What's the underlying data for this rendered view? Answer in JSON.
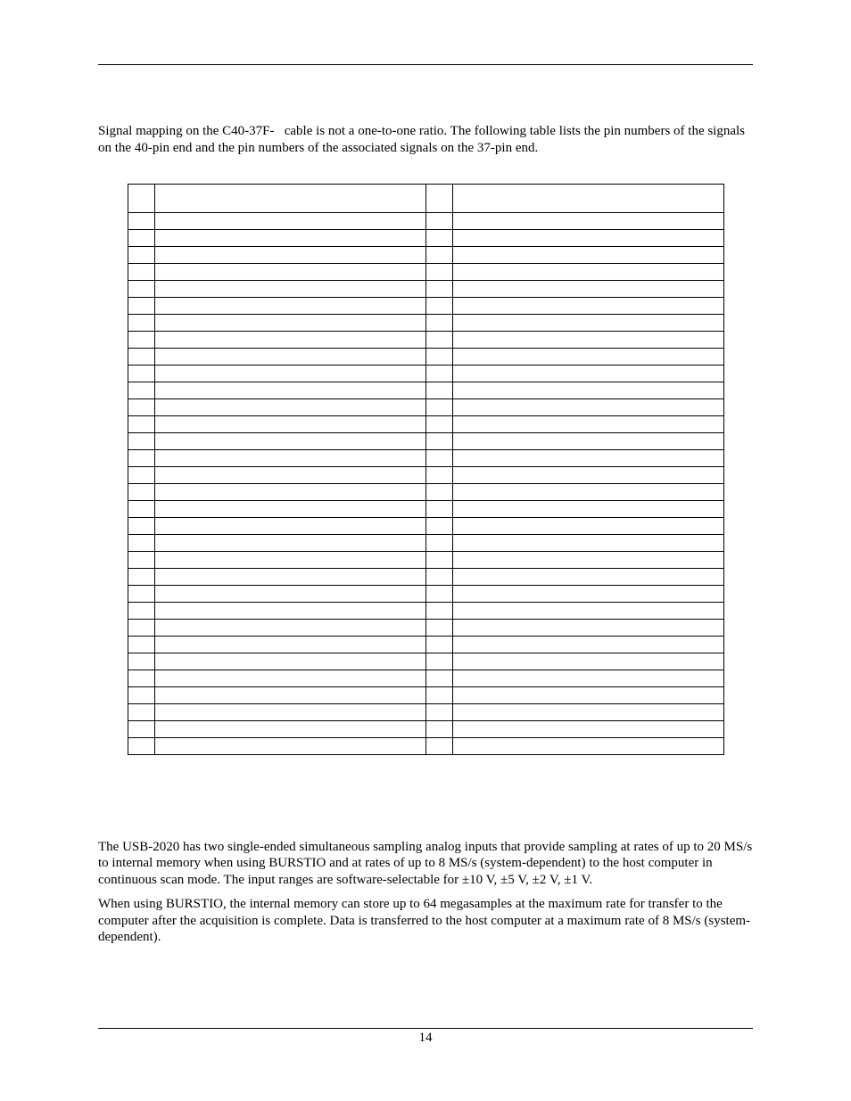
{
  "intro": {
    "text": "Signal mapping on the C40-37F-   cable is not a one-to-one ratio. The following table lists the pin numbers of the signals on the 40-pin end and the pin numbers of the associated signals on the 37-pin end."
  },
  "table": {
    "headers": {
      "left_pin": "",
      "left_signal": "",
      "right_pin": "",
      "right_signal": ""
    },
    "rows": [
      {
        "lp": "",
        "ls": "",
        "rp": "",
        "rs": ""
      },
      {
        "lp": "",
        "ls": "",
        "rp": "",
        "rs": ""
      },
      {
        "lp": "",
        "ls": "",
        "rp": "",
        "rs": ""
      },
      {
        "lp": "",
        "ls": "",
        "rp": "",
        "rs": ""
      },
      {
        "lp": "",
        "ls": "",
        "rp": "",
        "rs": ""
      },
      {
        "lp": "",
        "ls": "",
        "rp": "",
        "rs": ""
      },
      {
        "lp": "",
        "ls": "",
        "rp": "",
        "rs": ""
      },
      {
        "lp": "",
        "ls": "",
        "rp": "",
        "rs": ""
      },
      {
        "lp": "",
        "ls": "",
        "rp": "",
        "rs": ""
      },
      {
        "lp": "",
        "ls": "",
        "rp": "",
        "rs": ""
      },
      {
        "lp": "",
        "ls": "",
        "rp": "",
        "rs": ""
      },
      {
        "lp": "",
        "ls": "",
        "rp": "",
        "rs": ""
      },
      {
        "lp": "",
        "ls": "",
        "rp": "",
        "rs": ""
      },
      {
        "lp": "",
        "ls": "",
        "rp": "",
        "rs": ""
      },
      {
        "lp": "",
        "ls": "",
        "rp": "",
        "rs": ""
      },
      {
        "lp": "",
        "ls": "",
        "rp": "",
        "rs": ""
      },
      {
        "lp": "",
        "ls": "",
        "rp": "",
        "rs": ""
      },
      {
        "lp": "",
        "ls": "",
        "rp": "",
        "rs": ""
      },
      {
        "lp": "",
        "ls": "",
        "rp": "",
        "rs": ""
      },
      {
        "lp": "",
        "ls": "",
        "rp": "",
        "rs": ""
      },
      {
        "lp": "",
        "ls": "",
        "rp": "",
        "rs": ""
      },
      {
        "lp": "",
        "ls": "",
        "rp": "",
        "rs": ""
      },
      {
        "lp": "",
        "ls": "",
        "rp": "",
        "rs": ""
      },
      {
        "lp": "",
        "ls": "",
        "rp": "",
        "rs": ""
      },
      {
        "lp": "",
        "ls": "",
        "rp": "",
        "rs": ""
      },
      {
        "lp": "",
        "ls": "",
        "rp": "",
        "rs": ""
      },
      {
        "lp": "",
        "ls": "",
        "rp": "",
        "rs": ""
      },
      {
        "lp": "",
        "ls": "",
        "rp": "",
        "rs": ""
      },
      {
        "lp": "",
        "ls": "",
        "rp": "",
        "rs": ""
      },
      {
        "lp": "",
        "ls": "",
        "rp": "",
        "rs": ""
      },
      {
        "lp": "",
        "ls": "",
        "rp": "",
        "rs": ""
      },
      {
        "lp": "",
        "ls": "",
        "rp": "",
        "rs": ""
      }
    ]
  },
  "analog": {
    "p1": "The USB-2020 has two single-ended simultaneous sampling analog inputs that provide sampling at rates of up to 20 MS/s to internal memory when using BURSTIO and at rates of up to 8 MS/s (system-dependent) to the host computer in continuous scan mode. The input ranges are software-selectable for ±10 V, ±5 V, ±2 V, ±1 V.",
    "p2": "When using BURSTIO, the internal memory can store up to 64 megasamples at the maximum rate for transfer to the computer after the acquisition is complete. Data is transferred to the host computer at a maximum rate of 8 MS/s (system-dependent)."
  },
  "footer": {
    "page_number": "14"
  }
}
